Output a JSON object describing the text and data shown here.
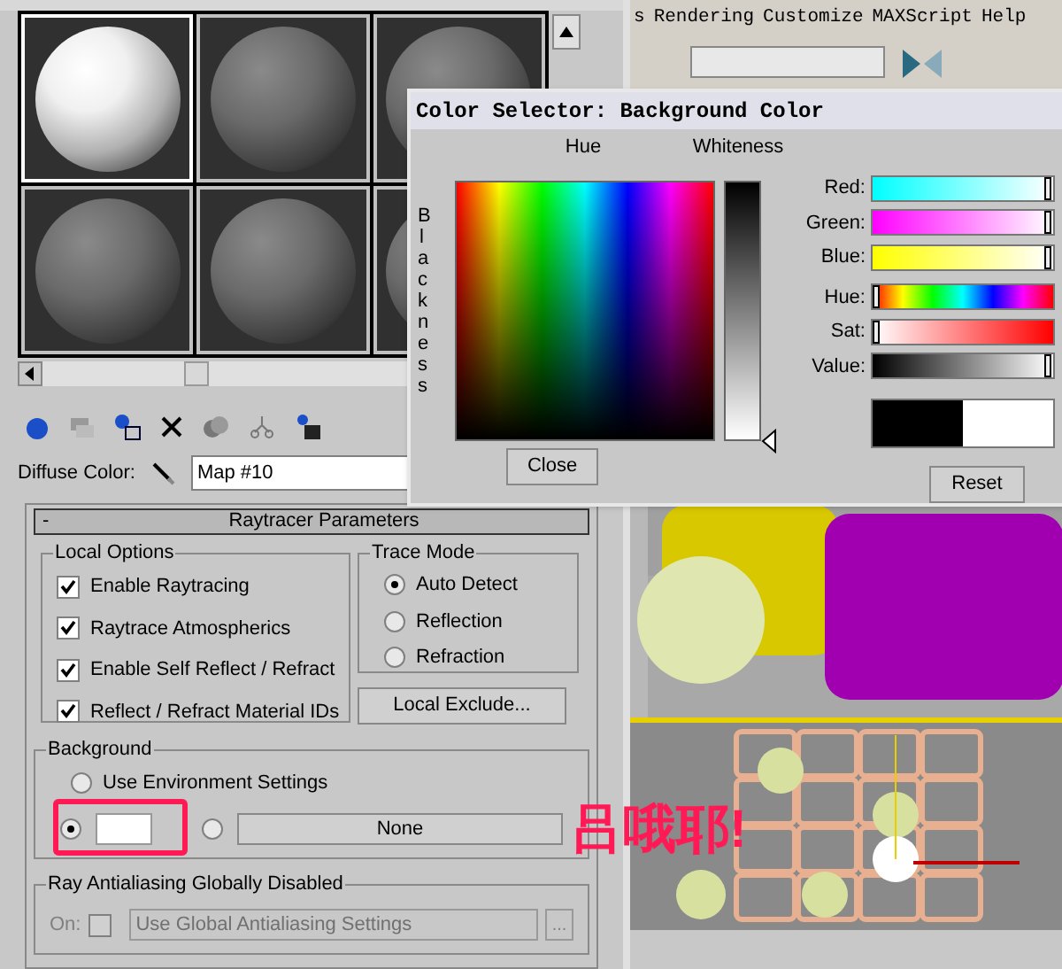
{
  "menu": [
    "s",
    "Rendering",
    "Customize",
    "MAXScript",
    "Help"
  ],
  "sample_slots": [
    {
      "selected": true,
      "lit": true
    },
    {
      "selected": false,
      "lit": false
    },
    {
      "selected": false,
      "lit": false
    },
    {
      "selected": false,
      "lit": false
    },
    {
      "selected": false,
      "lit": false
    },
    {
      "selected": false,
      "lit": false
    }
  ],
  "diffuse": {
    "label": "Diffuse Color:",
    "map": "Map #10"
  },
  "rollout": {
    "collapse": "-",
    "title": "Raytracer Parameters",
    "local_options": {
      "title": "Local Options",
      "items": [
        {
          "label": "Enable Raytracing",
          "checked": true
        },
        {
          "label": "Raytrace Atmospherics",
          "checked": true
        },
        {
          "label": "Enable Self Reflect / Refract",
          "checked": true
        },
        {
          "label": "Reflect / Refract Material IDs",
          "checked": true
        }
      ]
    },
    "trace_mode": {
      "title": "Trace Mode",
      "options": [
        {
          "label": "Auto Detect",
          "selected": true
        },
        {
          "label": "Reflection",
          "selected": false
        },
        {
          "label": "Refraction",
          "selected": false
        }
      ]
    },
    "local_exclude": "Local Exclude...",
    "background": {
      "title": "Background",
      "use_env": {
        "label": "Use Environment Settings",
        "selected": false
      },
      "color_option": {
        "selected": true,
        "color": "#ffffff"
      },
      "map_option": {
        "selected": false,
        "label": "None"
      }
    },
    "antialiasing": {
      "title": "Ray Antialiasing Globally Disabled",
      "on_label": "On:",
      "on_checked": false,
      "dropdown": "Use Global Antialiasing Settings",
      "more": "..."
    }
  },
  "color_selector": {
    "title": "Color Selector: Background Color",
    "hue_label": "Hue",
    "whiteness_label": "Whiteness",
    "blackness_label": "Blackness",
    "channels": [
      {
        "label": "Red:",
        "kind": "red",
        "level": 1
      },
      {
        "label": "Green:",
        "kind": "green",
        "level": 1
      },
      {
        "label": "Blue:",
        "kind": "blue",
        "level": 1
      },
      {
        "label": "Hue:",
        "kind": "hue",
        "level": 0
      },
      {
        "label": "Sat:",
        "kind": "sat",
        "level": 0
      },
      {
        "label": "Value:",
        "kind": "value",
        "level": 1
      }
    ],
    "swatches": [
      {
        "color": "#000000"
      },
      {
        "color": "#ffffff"
      }
    ],
    "close": "Close",
    "reset": "Reset"
  },
  "annotation": "吕哦耶!"
}
